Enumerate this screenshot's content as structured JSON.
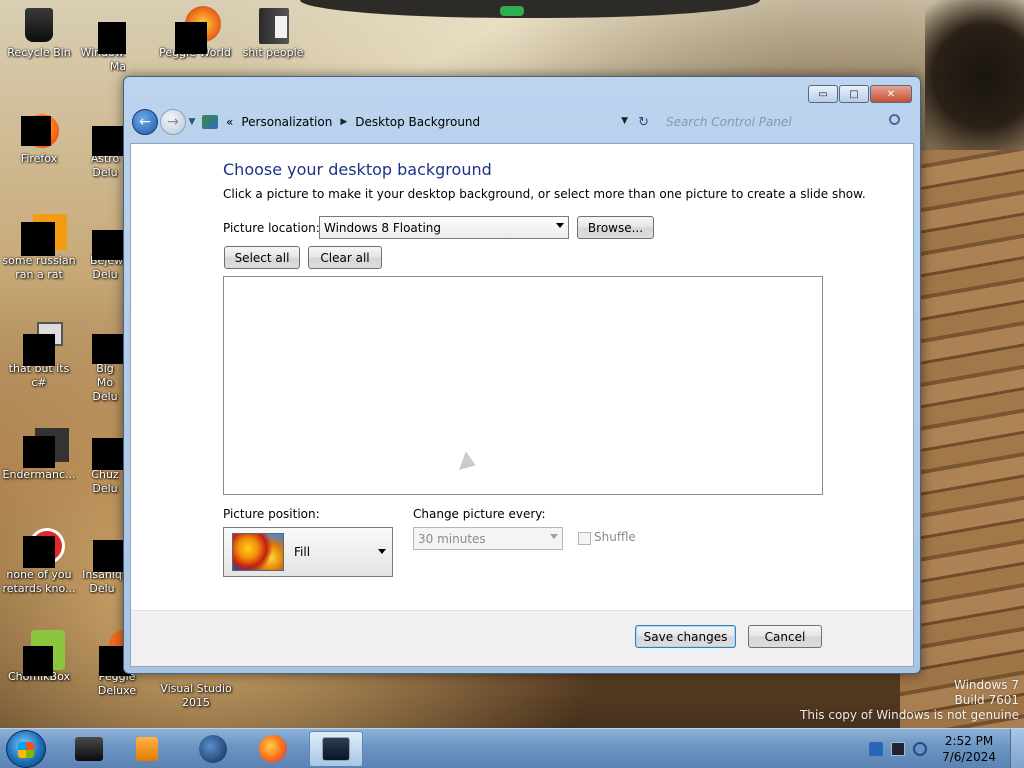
{
  "desktop": {
    "icons": [
      {
        "label": "Recycle Bin"
      },
      {
        "label": "Windows Live Ma"
      },
      {
        "label": "Peggle World"
      },
      {
        "label": "shit people"
      },
      {
        "label": "Firefox"
      },
      {
        "label": "Astro Delu"
      },
      {
        "label": "some russian ran a rat"
      },
      {
        "label": "Bejew Delu"
      },
      {
        "label": "that but its c#"
      },
      {
        "label": "Big Mo Delu"
      },
      {
        "label": "Endermanc..."
      },
      {
        "label": "Chuz Delu"
      },
      {
        "label": "none of you retards kno..."
      },
      {
        "label": "Insaniq Delu"
      },
      {
        "label": "ChomikBox"
      },
      {
        "label": "Peggle Deluxe"
      },
      {
        "label": "Visual Studio 2015"
      }
    ]
  },
  "window": {
    "breadcrumb": {
      "overflow": "«",
      "items": [
        "Personalization",
        "Desktop Background"
      ]
    },
    "search_placeholder": "Search Control Panel",
    "heading": "Choose your desktop background",
    "description": "Click a picture to make it your desktop background, or select more than one picture to create a slide show.",
    "picture_location_label": "Picture location:",
    "picture_location_value": "Windows 8 Floating",
    "browse_label": "Browse...",
    "select_all_label": "Select all",
    "clear_all_label": "Clear all",
    "picture_position_label": "Picture position:",
    "picture_position_value": "Fill",
    "change_every_label": "Change picture every:",
    "change_every_value": "30 minutes",
    "shuffle_label": "Shuffle",
    "save_label": "Save changes",
    "cancel_label": "Cancel",
    "controls": {
      "minimize": "▭",
      "maximize": "□",
      "close": "✕"
    }
  },
  "taskbar": {
    "time": "2:52 PM",
    "date": "7/6/2024"
  },
  "watermark": {
    "line1": "Windows 7",
    "line2": "Build 7601",
    "line3": "This copy of Windows is not genuine"
  },
  "colors": {
    "heading": "#1e3287",
    "taskbar": "#6c95c2"
  }
}
